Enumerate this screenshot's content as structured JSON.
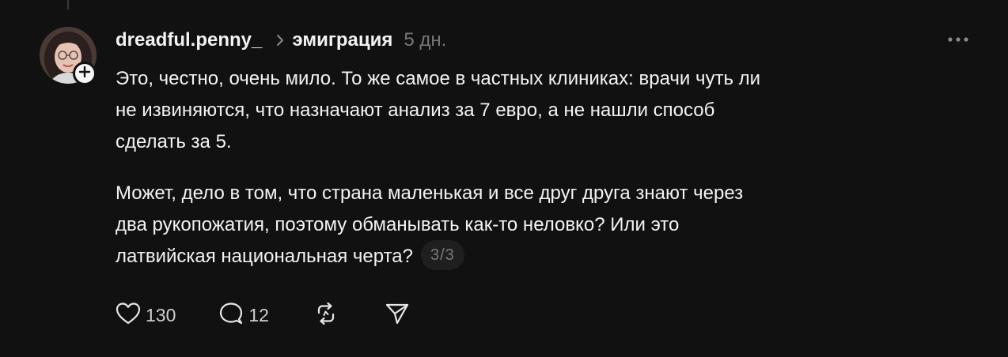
{
  "post": {
    "username": "dreadful.penny_",
    "topic": "эмиграция",
    "time": "5 дн.",
    "paragraphs": [
      [
        "Это, честно, очень мило. То же самое в частных клиниках: врачи чуть ли",
        "не извиняются, что назначают анализ за 7 евро, а не нашли способ",
        "сделать за 5."
      ],
      [
        "Может, дело в том, что страна маленькая и все друг друга знают через",
        "два рукопожатия, поэтому обманывать как-то неловко? Или это",
        "латвийская национальная черта?"
      ]
    ],
    "page_indicator": "3/3"
  },
  "actions": {
    "likes": "130",
    "replies": "12"
  },
  "icons": {
    "follow": "plus-icon",
    "separator": "chevron-right-icon",
    "more": "more-horizontal-icon",
    "like": "heart-icon",
    "reply": "comment-bubble-icon",
    "repost": "repost-icon",
    "share": "send-icon"
  },
  "colors": {
    "background": "#111111",
    "text": "#f3f3f3",
    "muted": "#777777",
    "badge_bg": "#1f1f1f"
  }
}
